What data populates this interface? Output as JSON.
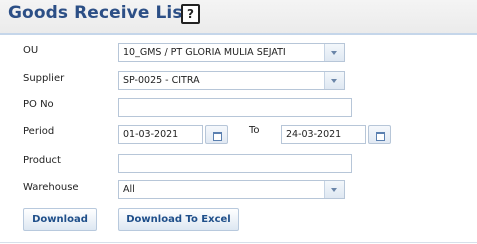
{
  "header": {
    "title": "Goods Receive List",
    "help_label": "?"
  },
  "form": {
    "ou": {
      "label": "OU",
      "value": "10_GMS / PT GLORIA MULIA SEJATI"
    },
    "supplier": {
      "label": "Supplier",
      "value": "SP-0025 - CITRA"
    },
    "po_no": {
      "label": "PO No",
      "value": ""
    },
    "period": {
      "label": "Period",
      "from": "01-03-2021",
      "to_label": "To",
      "to": "24-03-2021"
    },
    "product": {
      "label": "Product",
      "value": ""
    },
    "warehouse": {
      "label": "Warehouse",
      "value": "All"
    }
  },
  "buttons": {
    "download": "Download",
    "download_excel": "Download To Excel"
  },
  "icons": {
    "dropdown": "chevron-down-icon",
    "calendar": "calendar-icon",
    "help": "help-icon"
  }
}
